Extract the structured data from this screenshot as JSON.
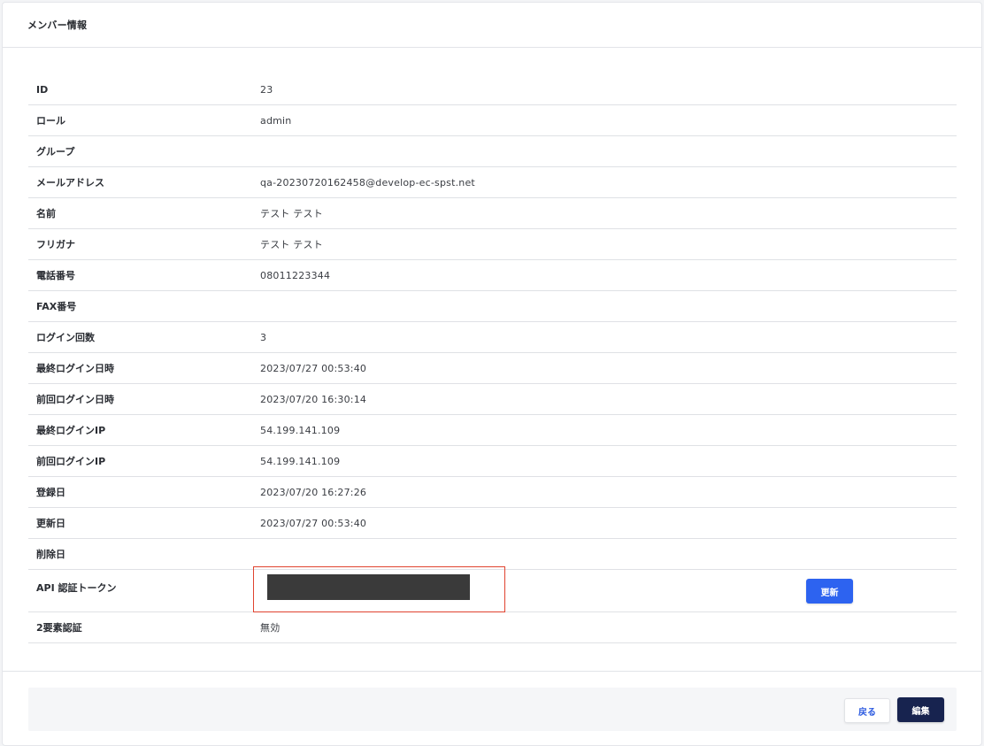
{
  "card": {
    "title": "メンバー情報"
  },
  "rows": [
    {
      "label": "ID",
      "value": "23"
    },
    {
      "label": "ロール",
      "value": "admin"
    },
    {
      "label": "グループ",
      "value": ""
    },
    {
      "label": "メールアドレス",
      "value": "qa-20230720162458@develop-ec-spst.net"
    },
    {
      "label": "名前",
      "value": "テスト テスト"
    },
    {
      "label": "フリガナ",
      "value": "テスト テスト"
    },
    {
      "label": "電話番号",
      "value": "08011223344"
    },
    {
      "label": "FAX番号",
      "value": ""
    },
    {
      "label": "ログイン回数",
      "value": "3"
    },
    {
      "label": "最終ログイン日時",
      "value": "2023/07/27 00:53:40"
    },
    {
      "label": "前回ログイン日時",
      "value": "2023/07/20 16:30:14"
    },
    {
      "label": "最終ログインIP",
      "value": "54.199.141.109"
    },
    {
      "label": "前回ログインIP",
      "value": "54.199.141.109"
    },
    {
      "label": "登録日",
      "value": "2023/07/20 16:27:26"
    },
    {
      "label": "更新日",
      "value": "2023/07/27 00:53:40"
    },
    {
      "label": "削除日",
      "value": ""
    }
  ],
  "token": {
    "label": "API 認証トークン",
    "refresh_label": "更新"
  },
  "two_factor": {
    "label": "2要素認証",
    "value": "無効"
  },
  "actions": {
    "back_label": "戻る",
    "edit_label": "編集"
  },
  "colors": {
    "primary": "#2d63f0",
    "dark_navy": "#17234f",
    "highlight_red": "#e0432f",
    "mask": "#3a3a3a"
  }
}
